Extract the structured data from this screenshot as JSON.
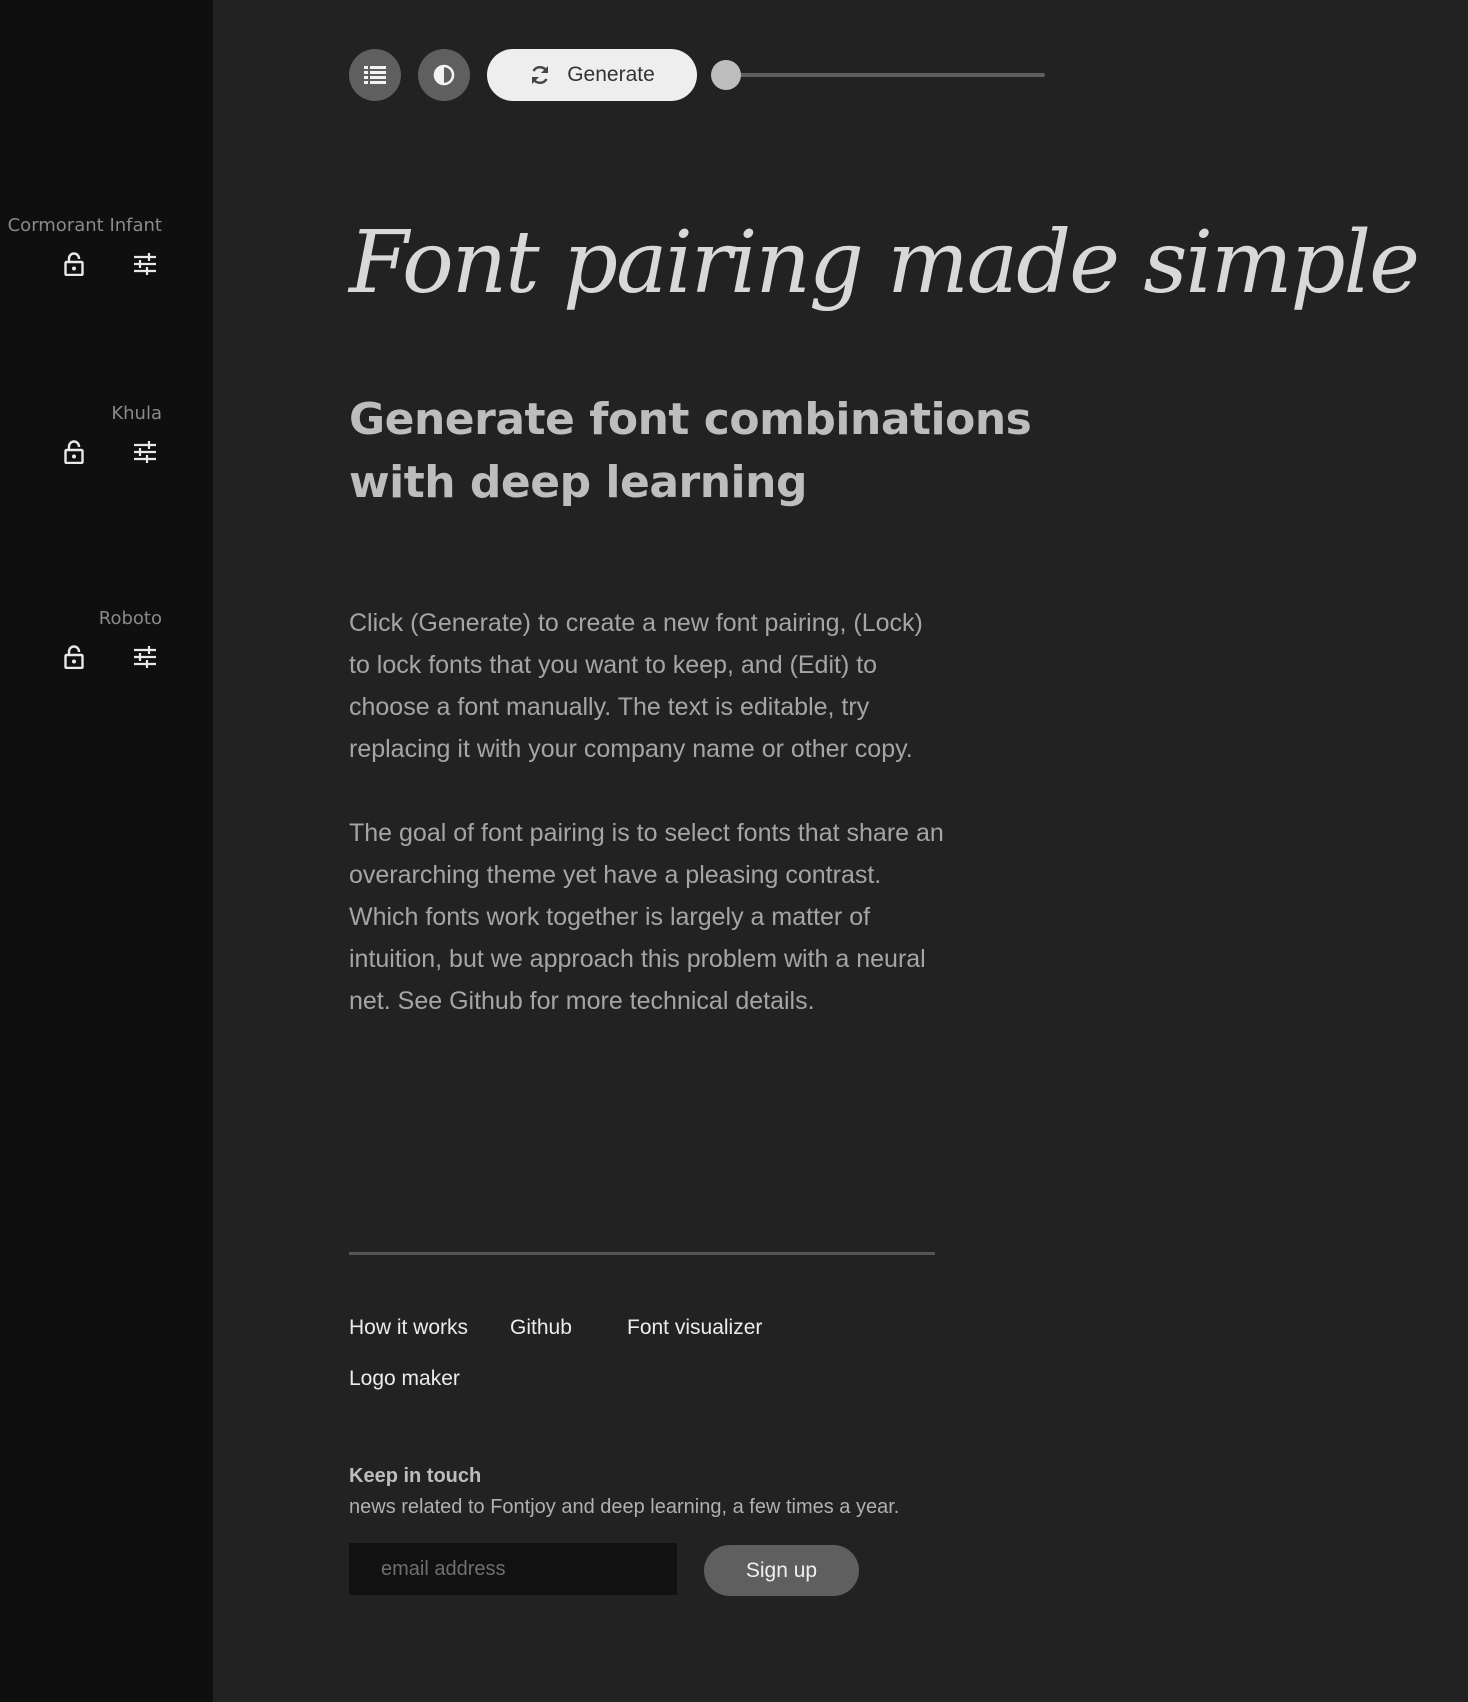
{
  "sidebar": {
    "fonts": [
      {
        "name": "Cormorant Infant",
        "lock_icon": "lock-open-icon",
        "edit_icon": "tune-icon"
      },
      {
        "name": "Khula",
        "lock_icon": "lock-open-icon",
        "edit_icon": "tune-icon"
      },
      {
        "name": "Roboto",
        "lock_icon": "lock-open-icon",
        "edit_icon": "tune-icon"
      }
    ]
  },
  "toolbar": {
    "list_icon": "list-icon",
    "contrast_icon": "contrast-icon",
    "generate_label": "Generate",
    "generate_icon": "refresh-icon",
    "slider_value": 0
  },
  "main": {
    "headline": "Font pairing made simple",
    "subheadline": "Generate font combinations with deep learning",
    "paragraph1": "Click (Generate) to create a new font pairing, (Lock) to lock fonts that you want to keep, and (Edit) to choose a font manually. The text is editable, try replacing it with your company name or other copy.",
    "paragraph2": "The goal of font pairing is to select fonts that share an overarching theme yet have a pleasing contrast. Which fonts work together is largely a matter of intuition, but we approach this problem with a neural net. See Github for more technical details."
  },
  "footer": {
    "links": [
      "How it works",
      "Github",
      "Font visualizer",
      "Logo maker"
    ],
    "keep_title": "Keep in touch",
    "keep_text": "news related to Fontjoy and deep learning, a few times a year.",
    "email_placeholder": "email address",
    "signup_label": "Sign up"
  },
  "colors": {
    "background": "#222222",
    "sidebar": "#0f0f0f",
    "accent_button": "#5f5f5f",
    "generate_button": "#eeeeee"
  }
}
